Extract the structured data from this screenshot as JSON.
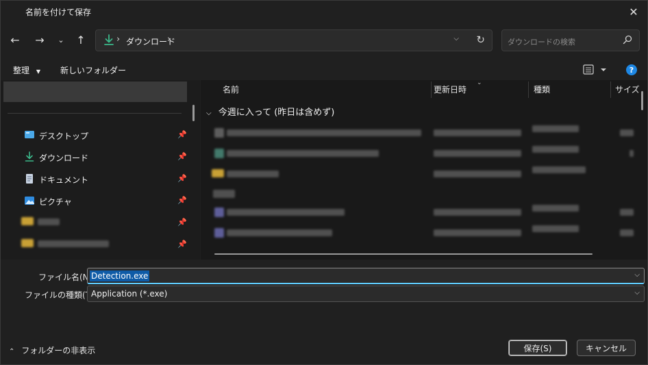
{
  "window": {
    "title": "名前を付けて保存",
    "close_icon": "close-icon"
  },
  "nav": {
    "back_icon": "arrow-left-icon",
    "forward_icon": "arrow-right-icon",
    "recent_icon": "chevron-down-icon",
    "up_icon": "arrow-up-icon",
    "address": {
      "location_icon": "download-icon",
      "current_folder": "ダウンロード"
    },
    "search_placeholder": "ダウンロードの検索"
  },
  "commandbar": {
    "organize_label": "整理",
    "new_folder_label": "新しいフォルダー",
    "view_icon": "view-list-icon",
    "help_label": "?"
  },
  "sidebar": {
    "items": [
      {
        "label": "デスクトップ",
        "icon": "desktop-icon",
        "pinned": true
      },
      {
        "label": "ダウンロード",
        "icon": "download-icon",
        "pinned": true
      },
      {
        "label": "ドキュメント",
        "icon": "document-icon",
        "pinned": true
      },
      {
        "label": "ピクチャ",
        "icon": "pictures-icon",
        "pinned": true
      }
    ]
  },
  "filelist": {
    "columns": [
      "名前",
      "更新日時",
      "種類",
      "サイズ"
    ],
    "group_label": "今週に入って (昨日は含めず)"
  },
  "form": {
    "filename_label": "ファイル名(N):",
    "filename_value": "Detection.exe",
    "filetype_label": "ファイルの種類(T):",
    "filetype_value": "Application (*.exe)"
  },
  "footer": {
    "hide_folders_label": "フォルダーの非表示",
    "save_label": "保存(S)",
    "cancel_label": "キャンセル"
  },
  "colors": {
    "accent": "#60cdff",
    "selection": "#0f5ba7",
    "help": "#1e88e5",
    "download_green": "#3bb88a"
  }
}
